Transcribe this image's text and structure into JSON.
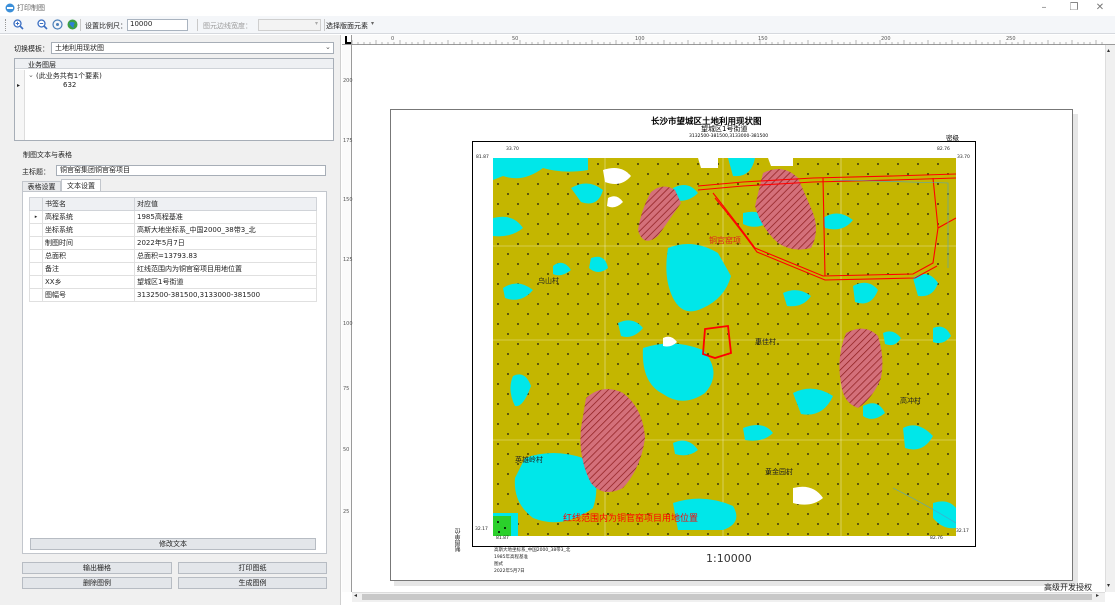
{
  "window": {
    "title": "打印制图"
  },
  "toolbar": {
    "scale_label": "设置比例尺：",
    "scale_value": "10000",
    "outline_label": "图元边线宽度：",
    "select_elements": "选择版面元素"
  },
  "left": {
    "template_label": "切换模板：",
    "template_value": "土地利用现状图",
    "business_layer": "业务图层",
    "tree_group": "(此业务共有1个要素)",
    "tree_item": "632",
    "section_title": "制图文本与表格",
    "main_title_label": "主标题：",
    "main_title_value": "铜官窑集团铜官窑项目",
    "tab_table": "表格设置",
    "tab_text": "文本设置",
    "grid_headers": [
      "书签名",
      "对应值"
    ],
    "grid_rows": [
      [
        "高程系统",
        "1985高程基准"
      ],
      [
        "坐标系统",
        "高斯大地坐标系_中国2000_38带3_北"
      ],
      [
        "制图时间",
        "2022年5月7日"
      ],
      [
        "总面积",
        "总面积=13793.83"
      ],
      [
        "备注",
        "红线范围内为铜官窑项目用地位置"
      ],
      [
        "XX乡",
        "望城区1号街道"
      ],
      [
        "图幅号",
        "3132500-381500,3133000-381500"
      ]
    ],
    "modify_text": "修改文本",
    "export_grid": "输出栅格",
    "print_map": "打印图纸",
    "delete_legend": "删除图例",
    "generate_legend": "生成图例"
  },
  "ruler": {
    "top_ticks": [
      "0",
      "50",
      "100",
      "150",
      "200",
      "250"
    ],
    "left_ticks": [
      "200",
      "175",
      "150",
      "125",
      "100",
      "75",
      "50",
      "25"
    ]
  },
  "map": {
    "title": "长沙市望城区土地利用现状图",
    "subtitle": "望城区1号街道",
    "sheet_no": "3132500-381500,3133000-381500",
    "secret": "密级",
    "coords": {
      "tl_top": "33.70",
      "tl_left": "81.87",
      "tr_top": "82.76",
      "tr_right": "33.70",
      "bl_left": "32.17",
      "bl_bottom": "81.87",
      "br_right": "32.17",
      "br_bottom": "82.76"
    },
    "villages": [
      "乌山村",
      "惠佳村",
      "高冲村",
      "英雄岭村",
      "黄金园村"
    ],
    "project_label": "铜官窑项",
    "redline_note": "红线范围内为铜官窑项目用地位置",
    "side_label": "制图单位",
    "footer_lines": [
      "高斯大地坐标系_中国2000_38带3_北",
      "1985年高程基准",
      "图式",
      "2022年5月7日"
    ],
    "scale_text": "1:10000",
    "colors": {
      "land": "#c4b600",
      "water": "#00e7e9",
      "built": "#d4707a",
      "redline": "#ff0000",
      "dots": "#000000"
    }
  },
  "status": {
    "watermark": "高级开发授权"
  }
}
